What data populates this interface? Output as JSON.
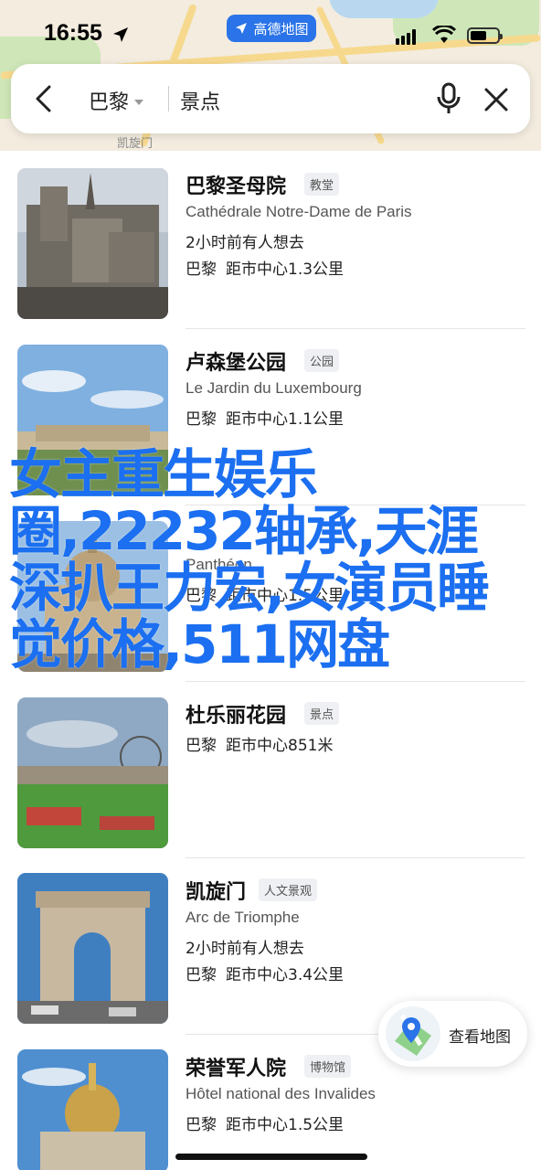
{
  "status_bar": {
    "time": "16:55",
    "app_name": "高德地图",
    "battery_level": 0.6
  },
  "search": {
    "city": "巴黎",
    "query": "景点"
  },
  "map_labels": [
    "凯旋门"
  ],
  "places": [
    {
      "name": "巴黎圣母院",
      "tag": "教堂",
      "name_local": "Cathédrale Notre-Dame de Paris",
      "recent": "2小时前有人想去",
      "city": "巴黎",
      "distance": "距市中心1.3公里",
      "thumb_theme": "cathedral"
    },
    {
      "name": "卢森堡公园",
      "tag": "公园",
      "name_local": "Le Jardin du Luxembourg",
      "recent": "",
      "city": "巴黎",
      "distance": "距市中心1.1公里",
      "thumb_theme": "palace-garden"
    },
    {
      "name": "",
      "tag": "",
      "name_local": "Panthéon",
      "recent": "",
      "city": "巴黎",
      "distance": "距市中心1.5公里",
      "thumb_theme": "pantheon"
    },
    {
      "name": "杜乐丽花园",
      "tag": "景点",
      "name_local": "",
      "recent": "",
      "city": "巴黎",
      "distance": "距市中心851米",
      "thumb_theme": "tuileries"
    },
    {
      "name": "凯旋门",
      "tag": "人文景观",
      "name_local": "Arc de Triomphe",
      "recent": "2小时前有人想去",
      "city": "巴黎",
      "distance": "距市中心3.4公里",
      "thumb_theme": "arc"
    },
    {
      "name": "荣誉军人院",
      "tag": "博物馆",
      "name_local": "Hôtel national des Invalides",
      "recent": "",
      "city": "巴黎",
      "distance": "距市中心1.5公里",
      "thumb_theme": "invalides"
    }
  ],
  "overlay_text": "女主重生娱乐圈,22232轴承,天涯深扒王力宏,女演员睡觉价格,511网盘",
  "map_button": {
    "label": "查看地图"
  },
  "colors": {
    "accent": "#2a73e8",
    "overlay": "#1b6ff0"
  }
}
